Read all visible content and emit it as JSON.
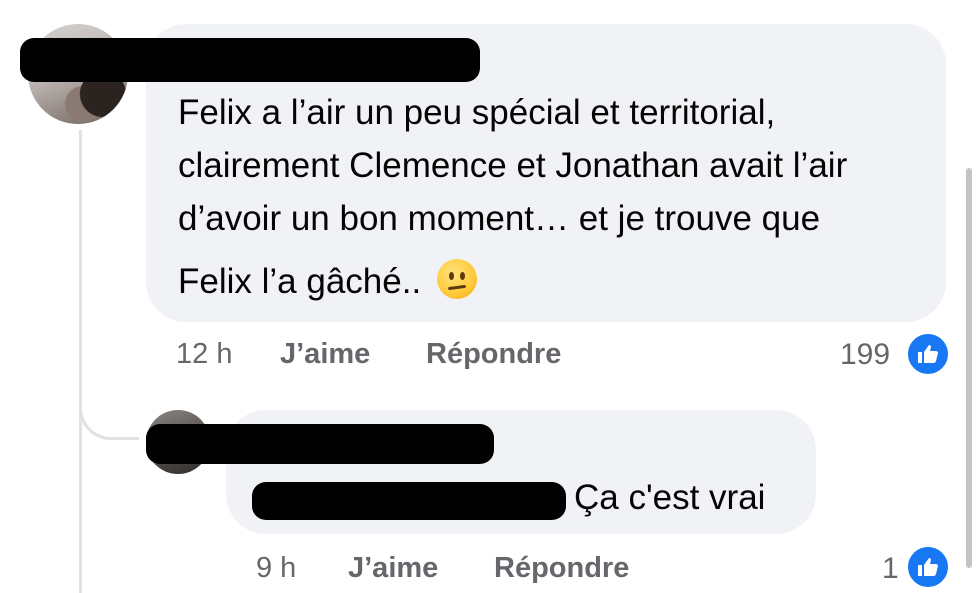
{
  "main_comment": {
    "text_lines": [
      "Felix a l’air un peu spécial et territorial,",
      "clairement Clemence et Jonathan avait l’air",
      "d’avoir un bon moment… et je trouve que",
      "Felix l’a gâché.."
    ],
    "emoji_icon": "confused-face-icon",
    "time": "12 h",
    "like_label": "J’aime",
    "reply_label": "Répondre",
    "reaction_count": "199",
    "reaction_icon": "thumbs-up-icon"
  },
  "reply_comment": {
    "text": "Ça c'est vrai",
    "time": "9 h",
    "like_label": "J’aime",
    "reply_label": "Répondre",
    "reaction_count": "1",
    "reaction_icon": "thumbs-up-icon"
  },
  "colors": {
    "bubble_bg": "#f0f2f5",
    "meta_text": "#65676b",
    "like_blue": "#1877f2"
  }
}
